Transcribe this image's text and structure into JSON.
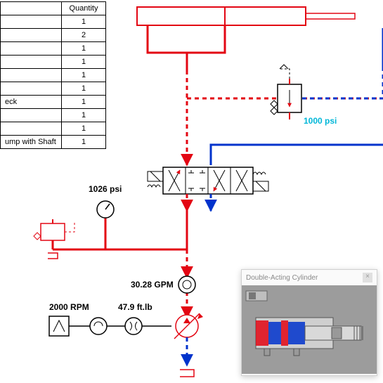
{
  "table": {
    "headers": {
      "desc": "",
      "qty": "Quantity"
    },
    "rows": [
      {
        "desc": "",
        "qty": "1"
      },
      {
        "desc": "",
        "qty": "2"
      },
      {
        "desc": "",
        "qty": "1"
      },
      {
        "desc": "",
        "qty": "1"
      },
      {
        "desc": "",
        "qty": "1"
      },
      {
        "desc": "",
        "qty": "1"
      },
      {
        "desc": "eck",
        "qty": "1"
      },
      {
        "desc": "",
        "qty": "1"
      },
      {
        "desc": "",
        "qty": "1"
      },
      {
        "desc": "ump with Shaft",
        "qty": "1"
      }
    ]
  },
  "labels": {
    "pressure_relief": "1000 psi",
    "gauge_pressure": "1026 psi",
    "flow_rate": "30.28 GPM",
    "rpm": "2000 RPM",
    "torque": "47.9 ft.lb"
  },
  "popup": {
    "title": "Double-Acting Cylinder",
    "close": "×"
  },
  "colors": {
    "pressure": "#e30613",
    "return": "#0033cc",
    "accent": "#00b7d8"
  }
}
